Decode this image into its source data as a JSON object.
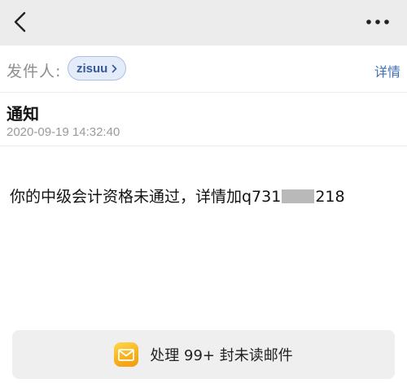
{
  "nav": {
    "back_icon": "chevron-left-icon",
    "more_icon": "ellipsis-horizontal-icon"
  },
  "sender": {
    "label": "发件人:",
    "name": "zisuu",
    "chip_icon": "chevron-right-icon",
    "details_label": "详情"
  },
  "message": {
    "subject": "通知",
    "datetime": "2020-09-19 14:32:40",
    "body_prefix": "你的中级会计资格未通过，详情加q731",
    "body_suffix": "218"
  },
  "footer": {
    "icon": "mail-envelope-icon",
    "label": "处理 99+ 封未读邮件"
  },
  "colors": {
    "nav_bg": "#ececec",
    "accent_blue": "#3d6db3",
    "chip_bg": "#e4ecf9",
    "badge_yellow": "#f7b21f"
  }
}
